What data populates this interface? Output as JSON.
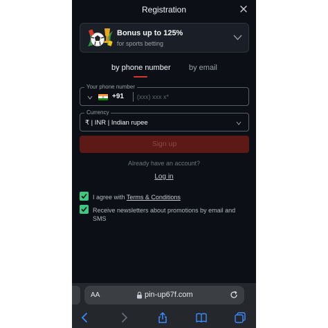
{
  "header": {
    "title": "Registration",
    "close_icon": "close-icon"
  },
  "bonus": {
    "title": "Bonus up to 125%",
    "subtitle": "for sports betting",
    "art_icon": "soccer-ball-trophy-icon",
    "chevron_icon": "chevron-down-icon"
  },
  "tabs": [
    {
      "label": "by phone number",
      "active": true
    },
    {
      "label": "by email",
      "active": false
    }
  ],
  "phone_field": {
    "label": "Your phone number",
    "country_code": "+91",
    "flag_icon": "india-flag-icon",
    "placeholder": "(xxx) xxx x*"
  },
  "currency_field": {
    "label": "Currency",
    "value": "₹ | INR | Indian rupee"
  },
  "signup_label": "Sign up",
  "login": {
    "prompt": "Already have an account?",
    "link": "Log in"
  },
  "checkboxes": [
    {
      "prefix": "I agree with ",
      "link": "Terms & Conditions",
      "checked": true
    },
    {
      "text": "Receive newsletters about promotions by email and SMS",
      "checked": true
    }
  ],
  "browser": {
    "aa_label": "AA",
    "url": "pin-up67f.com"
  },
  "colors": {
    "background": "#0c1016",
    "accent_red": "#d8382c",
    "signup_disabled": "#5c1916",
    "checkbox_green": "#3ec77e"
  }
}
